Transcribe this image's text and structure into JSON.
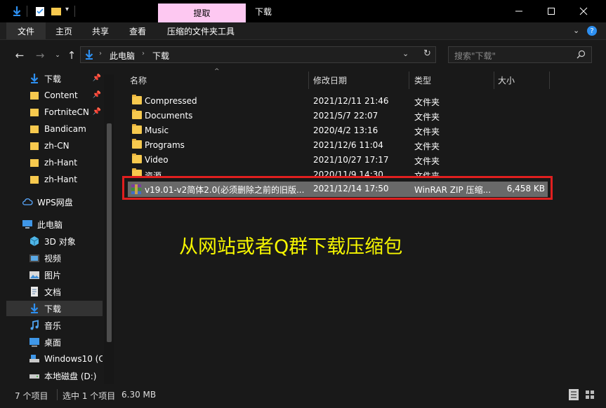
{
  "colors": {
    "titlebar": "#000000",
    "context_tab": "#fdc8f1",
    "folder": "#f7c94e",
    "selection_highlight": "#e01f1f",
    "overlay_text": "#f6f600",
    "selected_row": "#696969"
  },
  "titlebar": {
    "title": "下载",
    "context_tab": "提取",
    "icons": [
      "down-arrow-icon",
      "checklist-icon",
      "folder-icon",
      "dropdown-icon"
    ]
  },
  "ribbon": {
    "tabs": [
      "文件",
      "主页",
      "共享",
      "查看"
    ],
    "tool_tab": "压缩的文件夹工具"
  },
  "address": {
    "crumbs": [
      "此电脑",
      "下载"
    ],
    "search_placeholder": "搜索\"下载\""
  },
  "sidebar": {
    "quick_access": [
      {
        "label": "下载",
        "icon": "download-icon",
        "pinned": true
      },
      {
        "label": "Content",
        "icon": "folder-icon",
        "pinned": true
      },
      {
        "label": "FortniteCN",
        "icon": "folder-icon",
        "pinned": true
      },
      {
        "label": "Bandicam",
        "icon": "folder-icon",
        "pinned": false
      },
      {
        "label": "zh-CN",
        "icon": "folder-icon",
        "pinned": false
      },
      {
        "label": "zh-Hant",
        "icon": "folder-icon",
        "pinned": false
      },
      {
        "label": "zh-Hant",
        "icon": "folder-icon",
        "pinned": false
      }
    ],
    "wps": "WPS网盘",
    "this_pc": "此电脑",
    "pc_items": [
      {
        "label": "3D 对象",
        "icon": "3d-objects-icon"
      },
      {
        "label": "视频",
        "icon": "video-icon"
      },
      {
        "label": "图片",
        "icon": "pictures-icon"
      },
      {
        "label": "文档",
        "icon": "documents-icon"
      },
      {
        "label": "下载",
        "icon": "download-icon"
      },
      {
        "label": "音乐",
        "icon": "music-icon"
      },
      {
        "label": "桌面",
        "icon": "desktop-icon"
      },
      {
        "label": "Windows10 (C:",
        "icon": "drive-c-icon"
      },
      {
        "label": "本地磁盘 (D:)",
        "icon": "drive-d-icon"
      }
    ]
  },
  "columns": {
    "name": "名称",
    "date": "修改日期",
    "type": "类型",
    "size": "大小"
  },
  "files": [
    {
      "name": "Compressed",
      "date": "2021/12/11 21:46",
      "type": "文件夹",
      "size": ""
    },
    {
      "name": "Documents",
      "date": "2021/5/7 22:07",
      "type": "文件夹",
      "size": ""
    },
    {
      "name": "Music",
      "date": "2020/4/2 13:16",
      "type": "文件夹",
      "size": ""
    },
    {
      "name": "Programs",
      "date": "2021/12/6 11:04",
      "type": "文件夹",
      "size": ""
    },
    {
      "name": "Video",
      "date": "2021/10/27 17:17",
      "type": "文件夹",
      "size": ""
    },
    {
      "name": "资源",
      "date": "2020/11/9 14:30",
      "type": "文件夹",
      "size": ""
    },
    {
      "name": "v19.01-v2简体2.0(必须删除之前的旧版...",
      "date": "2021/12/14 17:50",
      "type": "WinRAR ZIP 压缩...",
      "size": "6,458 KB"
    }
  ],
  "overlay_caption": "从网站或者Q群下载压缩包",
  "status": {
    "items": "7 个项目",
    "selected": "选中 1 个项目",
    "size": "6.30 MB"
  }
}
